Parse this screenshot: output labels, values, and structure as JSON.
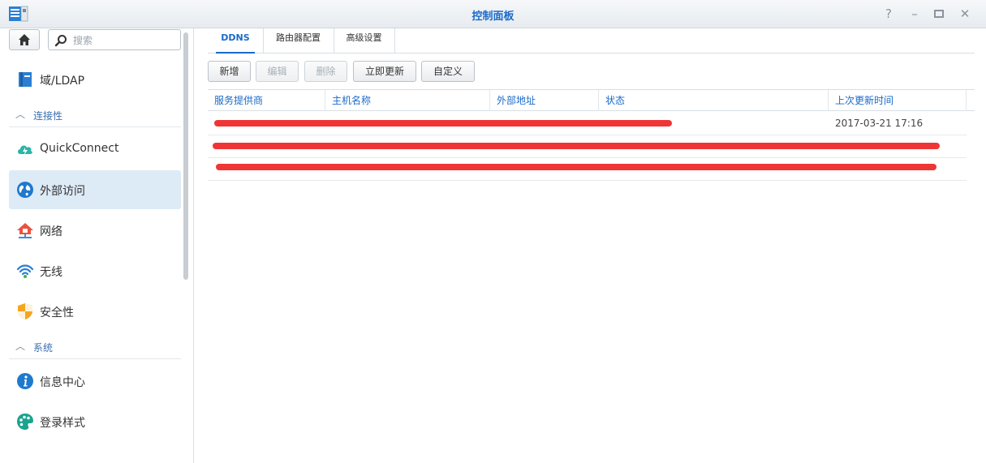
{
  "window": {
    "title": "控制面板"
  },
  "sidebar": {
    "search_placeholder": "搜索",
    "items": [
      {
        "label": "域/LDAP",
        "icon": "directory-icon"
      },
      {
        "section": "连接性"
      },
      {
        "label": "QuickConnect",
        "icon": "cloud-lightning-icon"
      },
      {
        "label": "外部访问",
        "icon": "globe-icon",
        "active": true
      },
      {
        "label": "网络",
        "icon": "network-house-icon"
      },
      {
        "label": "无线",
        "icon": "wifi-icon"
      },
      {
        "label": "安全性",
        "icon": "shield-icon"
      },
      {
        "section": "系统"
      },
      {
        "label": "信息中心",
        "icon": "info-icon"
      },
      {
        "label": "登录样式",
        "icon": "palette-icon"
      }
    ],
    "labels": {
      "ldap": "域/LDAP",
      "connectivity": "连接性",
      "quickconnect": "QuickConnect",
      "external_access": "外部访问",
      "network": "网络",
      "wireless": "无线",
      "security": "安全性",
      "system": "系统",
      "info_center": "信息中心",
      "login_style": "登录样式"
    }
  },
  "tabs": {
    "ddns": "DDNS",
    "router": "路由器配置",
    "advanced": "高级设置"
  },
  "toolbar": {
    "add": "新增",
    "edit": "编辑",
    "delete": "删除",
    "update_now": "立即更新",
    "customize": "自定义"
  },
  "table": {
    "columns": {
      "provider": "服务提供商",
      "hostname": "主机名称",
      "external_address": "外部地址",
      "status": "状态",
      "last_updated": "上次更新时间"
    },
    "rows": [
      {
        "last_updated": "2017-03-21 17:16"
      },
      {
        "last_updated": ""
      },
      {
        "last_updated": ""
      }
    ]
  },
  "colors": {
    "accent": "#1a6ac9",
    "active_bg": "#ddebf7",
    "redaction": "#ee2a2a"
  }
}
